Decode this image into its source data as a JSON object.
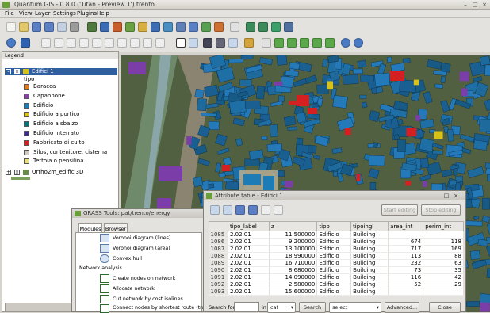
{
  "window": {
    "title": "Quantum GIS - 0.8.0 ('Titan - Preview 1') trento"
  },
  "menu": [
    "File",
    "View",
    "Layer",
    "Settings",
    "Plugins",
    "Help"
  ],
  "legend": {
    "header": "Legend",
    "layer1": "Edifici 1",
    "field": "tipo",
    "classes": [
      {
        "label": "Baracca",
        "color": "#e07b1a"
      },
      {
        "label": "Capannone",
        "color": "#8a3fa8"
      },
      {
        "label": "Edificio",
        "color": "#1d7bb5"
      },
      {
        "label": "Edificio a portico",
        "color": "#d8c218"
      },
      {
        "label": "Edificio a sbalzo",
        "color": "#0d6f7a"
      },
      {
        "label": "Edificio interrato",
        "color": "#3a2f86"
      },
      {
        "label": "Fabbricato di culto",
        "color": "#d42020"
      },
      {
        "label": "Silos, contenitore, cisterna",
        "color": "#cfc9bf"
      },
      {
        "label": "Tettoia o pensilina",
        "color": "#e9e07a"
      }
    ],
    "layer2": "Ortho2m_edifici3D"
  },
  "attribute_table": {
    "title": "Attribute table - Edifici 1",
    "start_editing": "Start editing",
    "stop_editing": "Stop editing",
    "columns": [
      "tipo_label",
      "z",
      "tipo",
      "tipoingl",
      "area_int",
      "perim_int"
    ],
    "rows": [
      [
        "1085",
        "2.02.01",
        "11.500000",
        "Edificio",
        "Building",
        "",
        ""
      ],
      [
        "1086",
        "2.02.01",
        "9.200000",
        "Edificio",
        "Building",
        "674",
        "118"
      ],
      [
        "1087",
        "2.02.01",
        "13.100000",
        "Edificio",
        "Building",
        "717",
        "169"
      ],
      [
        "1088",
        "2.02.01",
        "18.990000",
        "Edificio",
        "Building",
        "113",
        "88"
      ],
      [
        "1089",
        "2.02.01",
        "16.710000",
        "Edificio",
        "Building",
        "232",
        "63"
      ],
      [
        "1090",
        "2.02.01",
        "8.680000",
        "Edificio",
        "Building",
        "73",
        "35"
      ],
      [
        "1091",
        "2.02.01",
        "14.090000",
        "Edificio",
        "Building",
        "116",
        "42"
      ],
      [
        "1092",
        "2.02.01",
        "2.580000",
        "Edificio",
        "Building",
        "52",
        "29"
      ],
      [
        "1093",
        "2.02.01",
        "15.600000",
        "Edificio",
        "Building",
        "",
        ""
      ]
    ],
    "search_label": "Search for:",
    "in_label": "in",
    "field_select": "cat",
    "search_button": "Search",
    "mode_select": "select",
    "advanced_button": "Advanced...",
    "close_button": "Close"
  },
  "grass": {
    "title": "GRASS Tools: pat/trento/energy",
    "tabs": [
      "Modules",
      "Browser"
    ],
    "items": [
      "Voronoi diagram (lines)",
      "Voronoi diagram (area)",
      "Convex hull",
      "Network analysis",
      "Create nodes on network",
      "Allocate network",
      "Cut network by cost isolines",
      "Connect nodes by shortest route (traveling)"
    ]
  }
}
